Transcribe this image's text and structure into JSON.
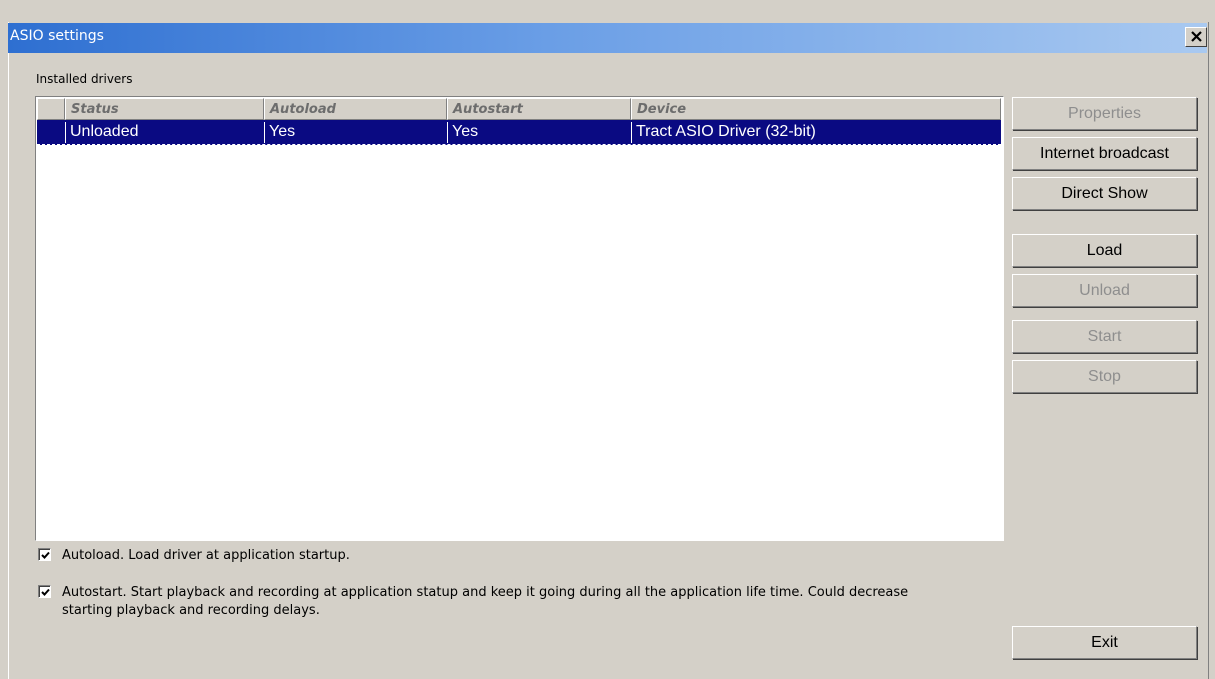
{
  "window": {
    "title": "ASIO settings",
    "close_label": "✕"
  },
  "drivers": {
    "group_label": "Installed drivers",
    "columns": [
      "Status",
      "Autoload",
      "Autostart",
      "Device"
    ],
    "rows": [
      {
        "status": "Unloaded",
        "autoload": "Yes",
        "autostart": "Yes",
        "device": "Tract ASIO Driver (32-bit)"
      }
    ]
  },
  "buttons": {
    "properties": "Properties",
    "internet_broadcast": "Internet broadcast",
    "direct_show": "Direct Show",
    "load": "Load",
    "unload": "Unload",
    "start": "Start",
    "stop": "Stop",
    "exit": "Exit"
  },
  "options": {
    "autoload": {
      "checked": true,
      "label": "Autoload. Load driver at application startup."
    },
    "autostart": {
      "checked": true,
      "label_line1": "Autostart. Start playback and recording at application statup and keep it going during all the application life time. Could decrease",
      "label_line2": "starting playback and recording delays."
    }
  },
  "colors": {
    "selection": "#0a0a82",
    "face": "#d4d0c8",
    "titlebar_start": "#2e6fd1"
  }
}
